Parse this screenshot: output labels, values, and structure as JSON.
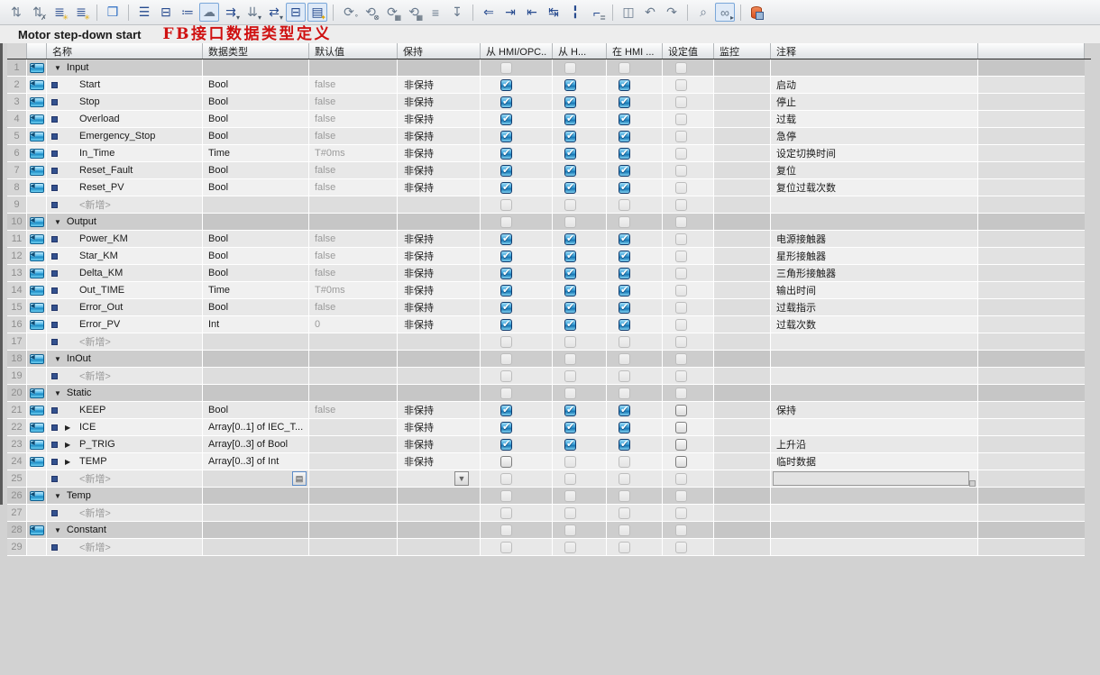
{
  "toolbar": {
    "icons": [
      {
        "name": "compare-values-icon",
        "glyph": "⇅",
        "color": "steel"
      },
      {
        "name": "discard-compare-icon",
        "glyph": "⇅",
        "color": "steel",
        "badge": "✗"
      },
      {
        "name": "insert-row-icon",
        "glyph": "≣",
        "color": "navy",
        "badge": "✳",
        "badge_gold": true
      },
      {
        "name": "add-row-icon",
        "glyph": "≣",
        "color": "navy",
        "badge": "✳",
        "badge_gold": true
      },
      {
        "sep": true
      },
      {
        "name": "block-interface-icon",
        "glyph": "❒",
        "color": "blue"
      },
      {
        "sep": true
      },
      {
        "name": "sort-lines-icon",
        "glyph": "☰",
        "color": "navy"
      },
      {
        "name": "collapse-all-icon",
        "glyph": "⊟",
        "color": "navy"
      },
      {
        "name": "expand-all-icon",
        "glyph": "≔",
        "color": "navy"
      },
      {
        "name": "comments-toggle-icon",
        "glyph": "☁",
        "color": "steel",
        "selected": true
      },
      {
        "name": "download-values-icon",
        "glyph": "⇉",
        "color": "navy",
        "badge": "▾"
      },
      {
        "name": "snapshot-values-icon",
        "glyph": "⇊",
        "color": "steel",
        "badge": "▾"
      },
      {
        "name": "copy-values-icon",
        "glyph": "⇄",
        "color": "navy",
        "badge": "▾"
      },
      {
        "name": "expanded-mode-icon",
        "glyph": "⊟",
        "color": "navy",
        "selected": true
      },
      {
        "name": "favorites-view-icon",
        "glyph": "▤",
        "color": "navy",
        "badge": "✦",
        "badge_gold": true,
        "selected": true
      },
      {
        "sep": true
      },
      {
        "name": "refresh-icon",
        "glyph": "⟳",
        "color": "steel",
        "badge": "°"
      },
      {
        "name": "cancel-refresh-icon",
        "glyph": "⟲",
        "color": "steel",
        "badge": "⊗"
      },
      {
        "name": "save-values-icon",
        "glyph": "⟳",
        "color": "steel",
        "badge": "▦"
      },
      {
        "name": "restore-values-icon",
        "glyph": "⟲",
        "color": "steel",
        "badge": "▦"
      },
      {
        "name": "wrap-text-icon",
        "glyph": "≡",
        "color": "steel"
      },
      {
        "name": "import-source-icon",
        "glyph": "↧",
        "color": "steel"
      },
      {
        "sep": true
      },
      {
        "name": "goto-definition-icon",
        "glyph": "⇐",
        "color": "navy"
      },
      {
        "name": "indent-icon",
        "glyph": "⇥",
        "color": "navy"
      },
      {
        "name": "outdent-icon",
        "glyph": "⇤",
        "color": "navy"
      },
      {
        "name": "update-interface-icon",
        "glyph": "↹",
        "color": "navy"
      },
      {
        "name": "insert-separator-icon",
        "glyph": "╏",
        "color": "navy"
      },
      {
        "name": "renumber-icon",
        "glyph": "⌐",
        "color": "navy",
        "badge": "≣"
      },
      {
        "sep": true
      },
      {
        "name": "bookmarks-icon",
        "glyph": "◫",
        "color": "steel"
      },
      {
        "name": "go-back-icon",
        "glyph": "↶",
        "color": "steel"
      },
      {
        "name": "go-forward-icon",
        "glyph": "↷",
        "color": "steel"
      },
      {
        "sep": true
      },
      {
        "name": "find-replace-icon",
        "glyph": "⌕",
        "color": "steel"
      },
      {
        "name": "monitor-all-icon",
        "glyph": "∞",
        "color": "steel",
        "badge": "▸",
        "selected": true
      },
      {
        "sep": true
      },
      {
        "name": "start-values-db-icon",
        "db": true
      }
    ]
  },
  "title_bar": {
    "block_name": "Motor step-down start",
    "annotation": "FB接口数据类型定义"
  },
  "table": {
    "headers": {
      "name": "名称",
      "datatype": "数据类型",
      "default": "默认值",
      "retain": "保持",
      "acc_hmi_opc": "从 HMI/OPC..",
      "acc_from_hmi": "从 H...",
      "vis_in_hmi": "在 HMI ...",
      "setpoint": "设定值",
      "supervision": "监控",
      "comment": "注释"
    },
    "retain_value": "非保持",
    "add_new_label": "<新增>",
    "rows": [
      {
        "num": "1",
        "kind": "section",
        "name": "Input",
        "cbs": [
          "d",
          "d",
          "d",
          "d"
        ]
      },
      {
        "num": "2",
        "kind": "member",
        "name": "Start",
        "datatype": "Bool",
        "default": "false",
        "retain": "非保持",
        "cbs": [
          "c",
          "c",
          "c",
          "d"
        ],
        "comment": "启动"
      },
      {
        "num": "3",
        "kind": "member",
        "name": "Stop",
        "datatype": "Bool",
        "default": "false",
        "retain": "非保持",
        "cbs": [
          "c",
          "c",
          "c",
          "d"
        ],
        "comment": "停止"
      },
      {
        "num": "4",
        "kind": "member",
        "name": "Overload",
        "datatype": "Bool",
        "default": "false",
        "retain": "非保持",
        "cbs": [
          "c",
          "c",
          "c",
          "d"
        ],
        "comment": "过载"
      },
      {
        "num": "5",
        "kind": "member",
        "name": "Emergency_Stop",
        "datatype": "Bool",
        "default": "false",
        "retain": "非保持",
        "cbs": [
          "c",
          "c",
          "c",
          "d"
        ],
        "comment": "急停"
      },
      {
        "num": "6",
        "kind": "member",
        "name": "In_Time",
        "datatype": "Time",
        "default": "T#0ms",
        "retain": "非保持",
        "cbs": [
          "c",
          "c",
          "c",
          "d"
        ],
        "comment": "设定切换时间"
      },
      {
        "num": "7",
        "kind": "member",
        "name": "Reset_Fault",
        "datatype": "Bool",
        "default": "false",
        "retain": "非保持",
        "cbs": [
          "c",
          "c",
          "c",
          "d"
        ],
        "comment": "复位"
      },
      {
        "num": "8",
        "kind": "member",
        "name": "Reset_PV",
        "datatype": "Bool",
        "default": "false",
        "retain": "非保持",
        "cbs": [
          "c",
          "c",
          "c",
          "d"
        ],
        "comment": "复位过载次数"
      },
      {
        "num": "9",
        "kind": "addnew",
        "cbs": [
          "d",
          "d",
          "d",
          "d"
        ]
      },
      {
        "num": "10",
        "kind": "section",
        "name": "Output",
        "cbs": [
          "d",
          "d",
          "d",
          "d"
        ]
      },
      {
        "num": "11",
        "kind": "member",
        "name": "Power_KM",
        "datatype": "Bool",
        "default": "false",
        "retain": "非保持",
        "cbs": [
          "c",
          "c",
          "c",
          "d"
        ],
        "comment": "电源接触器"
      },
      {
        "num": "12",
        "kind": "member",
        "name": "Star_KM",
        "datatype": "Bool",
        "default": "false",
        "retain": "非保持",
        "cbs": [
          "c",
          "c",
          "c",
          "d"
        ],
        "comment": "星形接触器"
      },
      {
        "num": "13",
        "kind": "member",
        "name": "Delta_KM",
        "datatype": "Bool",
        "default": "false",
        "retain": "非保持",
        "cbs": [
          "c",
          "c",
          "c",
          "d"
        ],
        "comment": "三角形接触器"
      },
      {
        "num": "14",
        "kind": "member",
        "name": "Out_TIME",
        "datatype": "Time",
        "default": "T#0ms",
        "retain": "非保持",
        "cbs": [
          "c",
          "c",
          "c",
          "d"
        ],
        "comment": "输出时间"
      },
      {
        "num": "15",
        "kind": "member",
        "name": "Error_Out",
        "datatype": "Bool",
        "default": "false",
        "retain": "非保持",
        "cbs": [
          "c",
          "c",
          "c",
          "d"
        ],
        "comment": "过载指示"
      },
      {
        "num": "16",
        "kind": "member",
        "name": "Error_PV",
        "datatype": "Int",
        "default": "0",
        "retain": "非保持",
        "cbs": [
          "c",
          "c",
          "c",
          "d"
        ],
        "comment": "过载次数"
      },
      {
        "num": "17",
        "kind": "addnew",
        "cbs": [
          "d",
          "d",
          "d",
          "d"
        ]
      },
      {
        "num": "18",
        "kind": "section",
        "name": "InOut",
        "cbs": [
          "d",
          "d",
          "d",
          "d"
        ]
      },
      {
        "num": "19",
        "kind": "addnew",
        "cbs": [
          "d",
          "d",
          "d",
          "d"
        ]
      },
      {
        "num": "20",
        "kind": "section",
        "name": "Static",
        "cbs": [
          "d",
          "d",
          "d",
          "d"
        ]
      },
      {
        "num": "21",
        "kind": "member",
        "name": "KEEP",
        "datatype": "Bool",
        "default": "false",
        "retain": "非保持",
        "cbs": [
          "c",
          "c",
          "c",
          "e"
        ],
        "comment": "保持"
      },
      {
        "num": "22",
        "kind": "member",
        "expand": true,
        "name": "ICE",
        "datatype": "Array[0..1] of IEC_T...",
        "retain": "非保持",
        "cbs": [
          "c",
          "c",
          "c",
          "e"
        ]
      },
      {
        "num": "23",
        "kind": "member",
        "expand": true,
        "name": "P_TRIG",
        "datatype": "Array[0..3] of Bool",
        "retain": "非保持",
        "cbs": [
          "c",
          "c",
          "c",
          "e"
        ],
        "comment": "上升沿"
      },
      {
        "num": "24",
        "kind": "member",
        "expand": true,
        "name": "TEMP",
        "datatype": "Array[0..3] of Int",
        "retain": "非保持",
        "cbs": [
          "e",
          "d",
          "d",
          "e"
        ],
        "comment": "临时数据"
      },
      {
        "num": "25",
        "kind": "addnew",
        "editing": true,
        "cbs": [
          "d",
          "d",
          "d",
          "d"
        ]
      },
      {
        "num": "26",
        "kind": "section",
        "name": "Temp",
        "cbs": [
          "d",
          "d",
          "d",
          "d"
        ]
      },
      {
        "num": "27",
        "kind": "addnew",
        "cbs": [
          "d",
          "d",
          "d",
          "d"
        ]
      },
      {
        "num": "28",
        "kind": "section",
        "name": "Constant",
        "cbs": [
          "d",
          "d",
          "d",
          "d"
        ]
      },
      {
        "num": "29",
        "kind": "addnew",
        "cbs": [
          "d",
          "d",
          "d",
          "d"
        ]
      }
    ]
  }
}
